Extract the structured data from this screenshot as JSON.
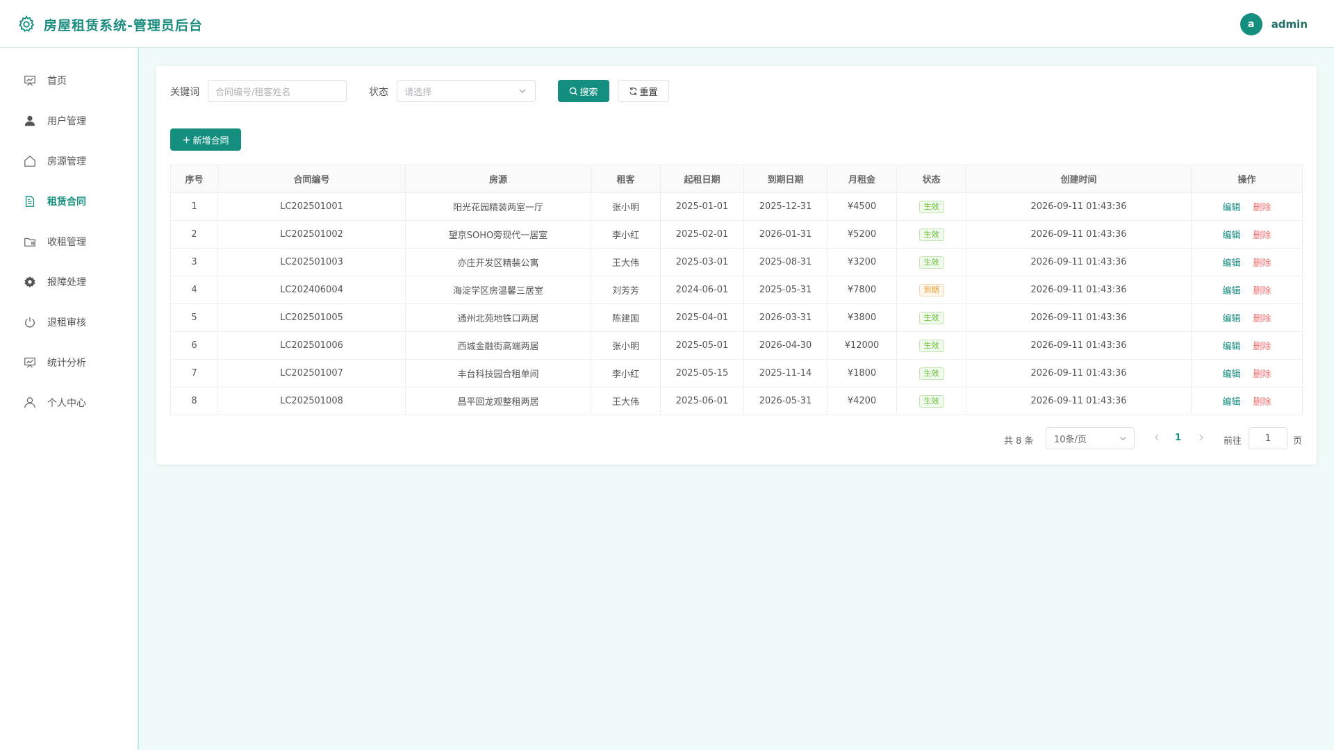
{
  "header": {
    "title": "房屋租赁系统-管理员后台",
    "avatar_letter": "a",
    "username": "admin"
  },
  "sidebar": {
    "items": [
      {
        "label": "首页",
        "icon": "dashboard-icon",
        "active": false
      },
      {
        "label": "用户管理",
        "icon": "user-icon",
        "active": false
      },
      {
        "label": "房源管理",
        "icon": "house-icon",
        "active": false
      },
      {
        "label": "租赁合同",
        "icon": "document-icon",
        "active": true
      },
      {
        "label": "收租管理",
        "icon": "wallet-icon",
        "active": false
      },
      {
        "label": "报障处理",
        "icon": "gear-icon",
        "active": false
      },
      {
        "label": "退租审核",
        "icon": "power-icon",
        "active": false
      },
      {
        "label": "统计分析",
        "icon": "chart-board-icon",
        "active": false
      },
      {
        "label": "个人中心",
        "icon": "person-icon",
        "active": false
      }
    ]
  },
  "search": {
    "keyword_label": "关键词",
    "keyword_placeholder": "合同编号/租客姓名",
    "status_label": "状态",
    "status_placeholder": "请选择",
    "search_button": "搜索",
    "reset_button": "重置"
  },
  "toolbar": {
    "add_button": "新增合同"
  },
  "table": {
    "columns": [
      "序号",
      "合同编号",
      "房源",
      "租客",
      "起租日期",
      "到期日期",
      "月租金",
      "状态",
      "创建时间",
      "操作"
    ],
    "rows": [
      {
        "no": "1",
        "code": "LC202501001",
        "house": "阳光花园精装两室一厅",
        "tenant": "张小明",
        "start": "2025-01-01",
        "end": "2025-12-31",
        "rent": "¥4500",
        "status": "生效",
        "created": "2026-09-11 01:43:36"
      },
      {
        "no": "2",
        "code": "LC202501002",
        "house": "望京SOHO旁现代一居室",
        "tenant": "李小红",
        "start": "2025-02-01",
        "end": "2026-01-31",
        "rent": "¥5200",
        "status": "生效",
        "created": "2026-09-11 01:43:36"
      },
      {
        "no": "3",
        "code": "LC202501003",
        "house": "亦庄开发区精装公寓",
        "tenant": "王大伟",
        "start": "2025-03-01",
        "end": "2025-08-31",
        "rent": "¥3200",
        "status": "生效",
        "created": "2026-09-11 01:43:36"
      },
      {
        "no": "4",
        "code": "LC202406004",
        "house": "海淀学区房温馨三居室",
        "tenant": "刘芳芳",
        "start": "2024-06-01",
        "end": "2025-05-31",
        "rent": "¥7800",
        "status": "到期",
        "created": "2026-09-11 01:43:36"
      },
      {
        "no": "5",
        "code": "LC202501005",
        "house": "通州北苑地铁口两居",
        "tenant": "陈建国",
        "start": "2025-04-01",
        "end": "2026-03-31",
        "rent": "¥3800",
        "status": "生效",
        "created": "2026-09-11 01:43:36"
      },
      {
        "no": "6",
        "code": "LC202501006",
        "house": "西城金融街高端两居",
        "tenant": "张小明",
        "start": "2025-05-01",
        "end": "2026-04-30",
        "rent": "¥12000",
        "status": "生效",
        "created": "2026-09-11 01:43:36"
      },
      {
        "no": "7",
        "code": "LC202501007",
        "house": "丰台科技园合租单间",
        "tenant": "李小红",
        "start": "2025-05-15",
        "end": "2025-11-14",
        "rent": "¥1800",
        "status": "生效",
        "created": "2026-09-11 01:43:36"
      },
      {
        "no": "8",
        "code": "LC202501008",
        "house": "昌平回龙观整租两居",
        "tenant": "王大伟",
        "start": "2025-06-01",
        "end": "2026-05-31",
        "rent": "¥4200",
        "status": "生效",
        "created": "2026-09-11 01:43:36"
      }
    ],
    "edit_label": "编辑",
    "delete_label": "删除"
  },
  "pagination": {
    "total_text": "共 8 条",
    "page_size": "10条/页",
    "current_page": "1",
    "goto_label": "前往",
    "goto_value": "1",
    "page_unit": "页"
  },
  "colors": {
    "primary": "#148f7f",
    "active_tag": "#67c23a",
    "expired_tag": "#e6a23c",
    "danger": "#f56c6c",
    "background": "#f0fbf9"
  }
}
